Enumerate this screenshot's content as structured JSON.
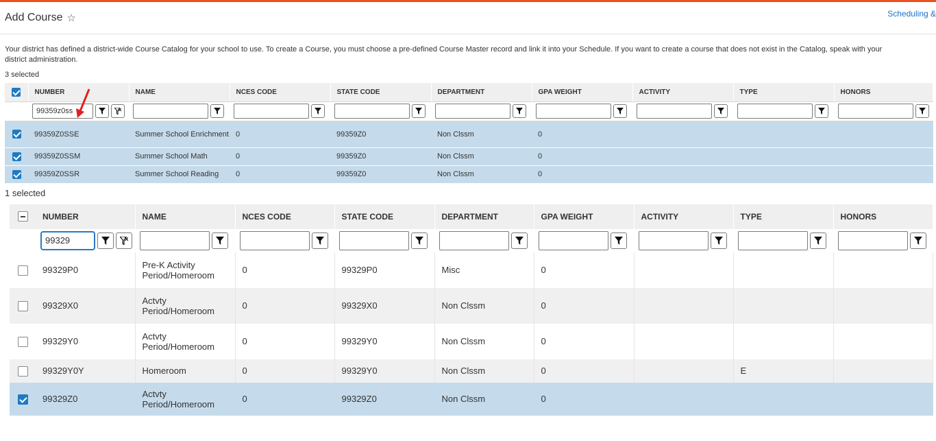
{
  "header": {
    "title": "Add Course",
    "star_icon": "star-outline-icon",
    "right_link": "Scheduling &"
  },
  "intro_text": "Your district has defined a district-wide Course Catalog for your school to use. To create a Course, you must choose a pre-defined Course Master record and link it into your Schedule. If you want to create a course that does not exist in the Catalog, speak with your district administration.",
  "table1": {
    "selected_label": "3 selected",
    "columns": [
      "NUMBER",
      "NAME",
      "NCES CODE",
      "STATE CODE",
      "DEPARTMENT",
      "GPA WEIGHT",
      "ACTIVITY",
      "TYPE",
      "HONORS"
    ],
    "number_filter_value": "99359z0ss",
    "rows": [
      {
        "number": "99359Z0SSE",
        "name": "Summer School Enrichment",
        "nces": "0",
        "state": "99359Z0",
        "dept": "Non Clssm",
        "gpa": "0",
        "activity": "",
        "type": "",
        "honors": ""
      },
      {
        "number": "99359Z0SSM",
        "name": "Summer School Math",
        "nces": "0",
        "state": "99359Z0",
        "dept": "Non Clssm",
        "gpa": "0",
        "activity": "",
        "type": "",
        "honors": ""
      },
      {
        "number": "99359Z0SSR",
        "name": "Summer School Reading",
        "nces": "0",
        "state": "99359Z0",
        "dept": "Non Clssm",
        "gpa": "0",
        "activity": "",
        "type": "",
        "honors": ""
      }
    ]
  },
  "table2": {
    "selected_label": "1 selected",
    "columns": [
      "NUMBER",
      "NAME",
      "NCES CODE",
      "STATE CODE",
      "DEPARTMENT",
      "GPA WEIGHT",
      "ACTIVITY",
      "TYPE",
      "HONORS"
    ],
    "number_filter_value": "99329",
    "rows": [
      {
        "number": "99329P0",
        "name": "Pre-K Activity Period/Homeroom",
        "nces": "0",
        "state": "99329P0",
        "dept": "Misc",
        "gpa": "0",
        "activity": "",
        "type": "",
        "honors": ""
      },
      {
        "number": "99329X0",
        "name": "Actvty Period/Homeroom",
        "nces": "0",
        "state": "99329X0",
        "dept": "Non Clssm",
        "gpa": "0",
        "activity": "",
        "type": "",
        "honors": ""
      },
      {
        "number": "99329Y0",
        "name": "Actvty Period/Homeroom",
        "nces": "0",
        "state": "99329Y0",
        "dept": "Non Clssm",
        "gpa": "0",
        "activity": "",
        "type": "",
        "honors": ""
      },
      {
        "number": "99329Y0Y",
        "name": "Homeroom",
        "nces": "0",
        "state": "99329Y0",
        "dept": "Non Clssm",
        "gpa": "0",
        "activity": "",
        "type": "E",
        "honors": ""
      },
      {
        "number": "99329Z0",
        "name": "Actvty Period/Homeroom",
        "nces": "0",
        "state": "99329Z0",
        "dept": "Non Clssm",
        "gpa": "0",
        "activity": "",
        "type": "",
        "honors": ""
      }
    ]
  },
  "colors": {
    "accent": "#e8531e",
    "selected_row": "#c5dbeb",
    "checkbox": "#1f7ac2",
    "link": "#1a73c8",
    "annotation_arrow": "#e02020"
  }
}
